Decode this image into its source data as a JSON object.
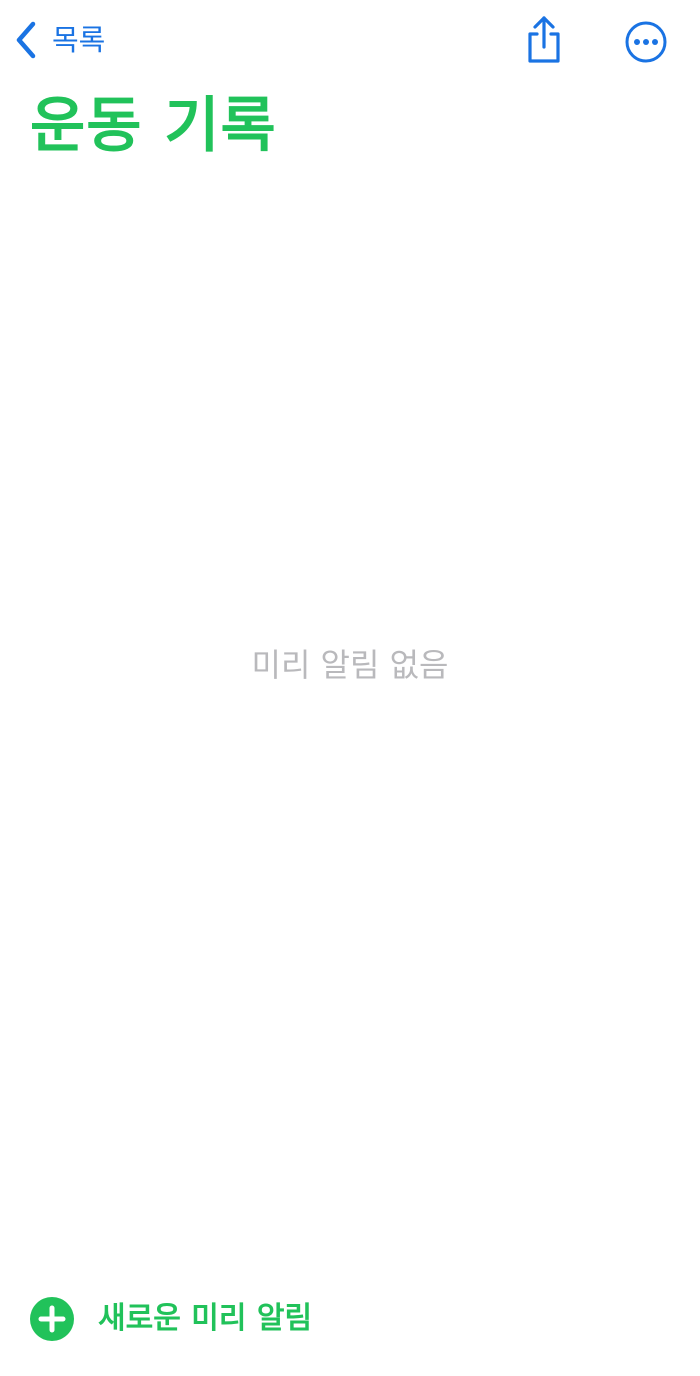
{
  "nav": {
    "back_label": "목록"
  },
  "list": {
    "title": "운동 기록",
    "empty_message": "미리 알림 없음"
  },
  "footer": {
    "new_reminder_label": "새로운 미리 알림"
  },
  "icons": {
    "back": "chevron-left-icon",
    "share": "share-icon",
    "more": "ellipsis-circle-icon",
    "add": "plus-circle-icon"
  },
  "colors": {
    "accent": "#1a73e3",
    "list_color": "#21c25a",
    "placeholder": "#b9b9bc",
    "background": "#ffffff"
  }
}
